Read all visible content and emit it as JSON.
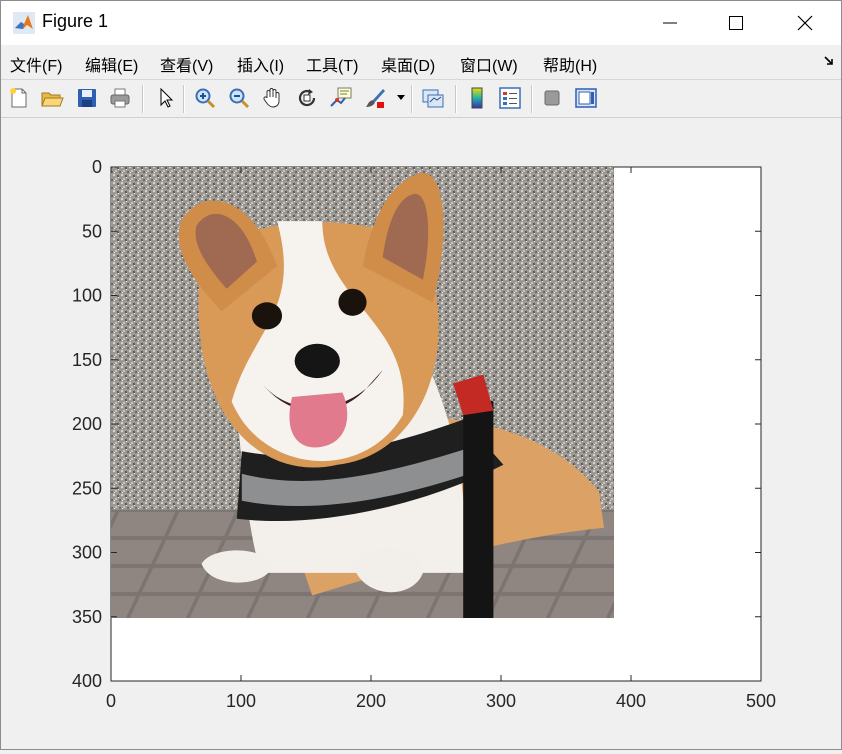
{
  "window": {
    "title": "Figure 1"
  },
  "menu": [
    {
      "label": "文件(F)"
    },
    {
      "label": "编辑(E)"
    },
    {
      "label": "查看(V)"
    },
    {
      "label": "插入(I)"
    },
    {
      "label": "工具(T)"
    },
    {
      "label": "桌面(D)"
    },
    {
      "label": "窗口(W)"
    },
    {
      "label": "帮助(H)"
    }
  ],
  "toolbar": {
    "icons": [
      "new-figure-icon",
      "open-icon",
      "save-icon",
      "print-icon",
      "pointer-icon",
      "zoom-in-icon",
      "zoom-out-icon",
      "pan-hand-icon",
      "rotate-3d-icon",
      "data-cursor-icon",
      "brush-icon",
      "link-plot-icon",
      "colorbar-icon",
      "legend-icon",
      "hide-plot-tools-icon",
      "show-plot-tools-icon"
    ]
  },
  "colors": {
    "axes_bg": "#ffffff",
    "figure_bg": "#f0f0f0",
    "text": "#262626"
  },
  "chart_data": {
    "type": "image",
    "content": "photo of a corgi dog wearing a harness, lying on paving stones in front of a granite wall",
    "image_extent": {
      "width": 387,
      "height": 351
    },
    "xlim": [
      0,
      500
    ],
    "ylim": [
      0,
      400
    ],
    "y_direction": "reverse",
    "xticks": [
      0,
      100,
      200,
      300,
      400,
      500
    ],
    "yticks": [
      0,
      50,
      100,
      150,
      200,
      250,
      300,
      350,
      400
    ],
    "xlabel": "",
    "ylabel": "",
    "title": ""
  }
}
